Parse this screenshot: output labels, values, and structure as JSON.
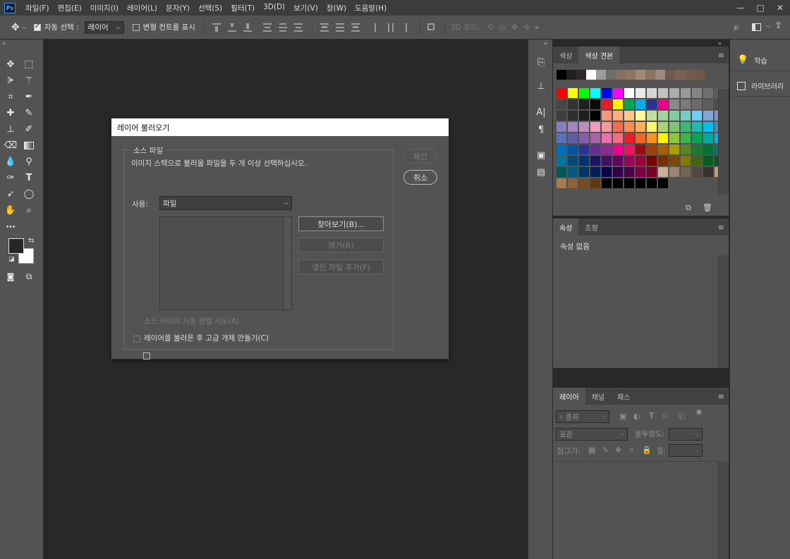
{
  "app": {
    "logo": "Ps"
  },
  "menubar": {
    "items": [
      "파일(F)",
      "편집(E)",
      "이미지(I)",
      "레이어(L)",
      "문자(Y)",
      "선택(S)",
      "필터(T)",
      "3D(D)",
      "보기(V)",
      "창(W)",
      "도움말(H)"
    ],
    "window_controls": [
      "—",
      "□",
      "✕"
    ]
  },
  "options": {
    "auto_select_label": "자동 선택 :",
    "auto_select_checked": true,
    "auto_select_value": "레이어",
    "transform_controls_label": "변형 컨트롤 표시",
    "transform_controls_checked": false,
    "mode_3d_label": "3D 모드:"
  },
  "dialog": {
    "title": "레이어 불러오기",
    "group_label": "소스 파일",
    "instruction": "이미지 스택으로 불러올 파일을 두 개 이상 선택하십시오.",
    "use_label": "사용:",
    "use_value": "파일",
    "browse_button": "찾아보기(B)...",
    "remove_button": "제거(R)",
    "add_open_files_button": "열린 파일 추가(F)",
    "ok_button": "확인",
    "cancel_button": "취소",
    "auto_align_label": "소스 이미지 자동 정렬 시도(A)",
    "auto_align_checked": false,
    "smart_object_label": "레이어를 불러온 후 고급 개체 만들기(C)",
    "smart_object_checked": false
  },
  "swatches_panel": {
    "tabs": [
      "색상",
      "색상 견본"
    ],
    "active_tab": "색상 견본",
    "recent_colors": [
      "#000000",
      "#231f20",
      "#2e2a2b",
      "#ffffff",
      "#9c9c9c",
      "#6d6d6d",
      "#86705f",
      "#8e7462",
      "#a28a76",
      "#8d7361",
      "#9c8a7d",
      "#6e5a4e",
      "#7a6152",
      "#725b4f",
      "#6f5a4e"
    ],
    "grid": [
      [
        "#ff0000",
        "#ffff00",
        "#00ff00",
        "#00ffff",
        "#0000ff",
        "#ff00ff",
        "#ffffff",
        "#ebebeb",
        "#d6d6d6",
        "#c2c2c2",
        "#adadad",
        "#999999",
        "#858585",
        "#707070",
        "#5c5c5c"
      ],
      [
        "#474747",
        "#333333",
        "#1f1f1f",
        "#0a0a0a",
        "#ed1c24",
        "#fff200",
        "#00a651",
        "#00aeef",
        "#2e3192",
        "#ec008c",
        "#898989",
        "#7a7a7a",
        "#6b6b6b",
        "#5c5c5c",
        "#4d4d4d"
      ],
      [
        "#3d3d3d",
        "#2e2e2e",
        "#1f1f1f",
        "#000000",
        "#f69679",
        "#f9ad81",
        "#fdc689",
        "#fff799",
        "#c4df9b",
        "#a3d39c",
        "#82ca9c",
        "#7accc8",
        "#6dcff6",
        "#7da7d9",
        "#8393ca"
      ],
      [
        "#8781bd",
        "#a186be",
        "#bd8cbf",
        "#f49ac1",
        "#f5989d",
        "#f26c4f",
        "#f68e56",
        "#fbaf5d",
        "#fff467",
        "#acd373",
        "#7cc576",
        "#3bb878",
        "#1abbb4",
        "#00bff3",
        "#438ccb"
      ],
      [
        "#5574b9",
        "#605ca8",
        "#855fa8",
        "#a763a8",
        "#f06eaa",
        "#f26d7d",
        "#ed1c24",
        "#f26522",
        "#f7941d",
        "#fff200",
        "#8dc63f",
        "#39b54a",
        "#00a651",
        "#00a99d",
        "#00aeef"
      ],
      [
        "#0072bc",
        "#0054a6",
        "#2e3192",
        "#662d91",
        "#92278f",
        "#ec008c",
        "#ed145b",
        "#9e0b0f",
        "#a0410d",
        "#a36209",
        "#aba000",
        "#598527",
        "#197b30",
        "#007236",
        "#00746b"
      ],
      [
        "#0076a3",
        "#004a80",
        "#003471",
        "#1b1464",
        "#440e62",
        "#630460",
        "#9e005d",
        "#9e0039",
        "#790000",
        "#7b2e00",
        "#7d4900",
        "#827b00",
        "#406618",
        "#005e20",
        "#005826"
      ],
      [
        "#005952",
        "#005b7f",
        "#003663",
        "#002157",
        "#0d004c",
        "#32004b",
        "#4b0049",
        "#7b0046",
        "#7a0026",
        "#c7b299",
        "#998675",
        "#736357",
        "#534741",
        "#37302d",
        "#c69c6d"
      ],
      [
        "#a67c52",
        "#8c6239",
        "#754c24",
        "#603913",
        "#000000",
        "#000000",
        "#000000",
        "#000000",
        "#000000",
        "#000000",
        "#000000",
        "#000000",
        "#000000",
        "#000000",
        "#000000"
      ]
    ]
  },
  "properties_panel": {
    "tabs": [
      "속성",
      "조정"
    ],
    "active_tab": "속성",
    "empty_text": "속성 없음"
  },
  "layers_panel": {
    "tabs": [
      "레이어",
      "채널",
      "패스"
    ],
    "active_tab": "레이어",
    "filter_label": "종류",
    "blend_mode": "표준",
    "opacity_label": "불투명도:",
    "lock_label": "잠그기:",
    "fill_label": "칠:"
  },
  "far_right_panel": {
    "items": [
      "학습",
      "라이브러리"
    ]
  }
}
